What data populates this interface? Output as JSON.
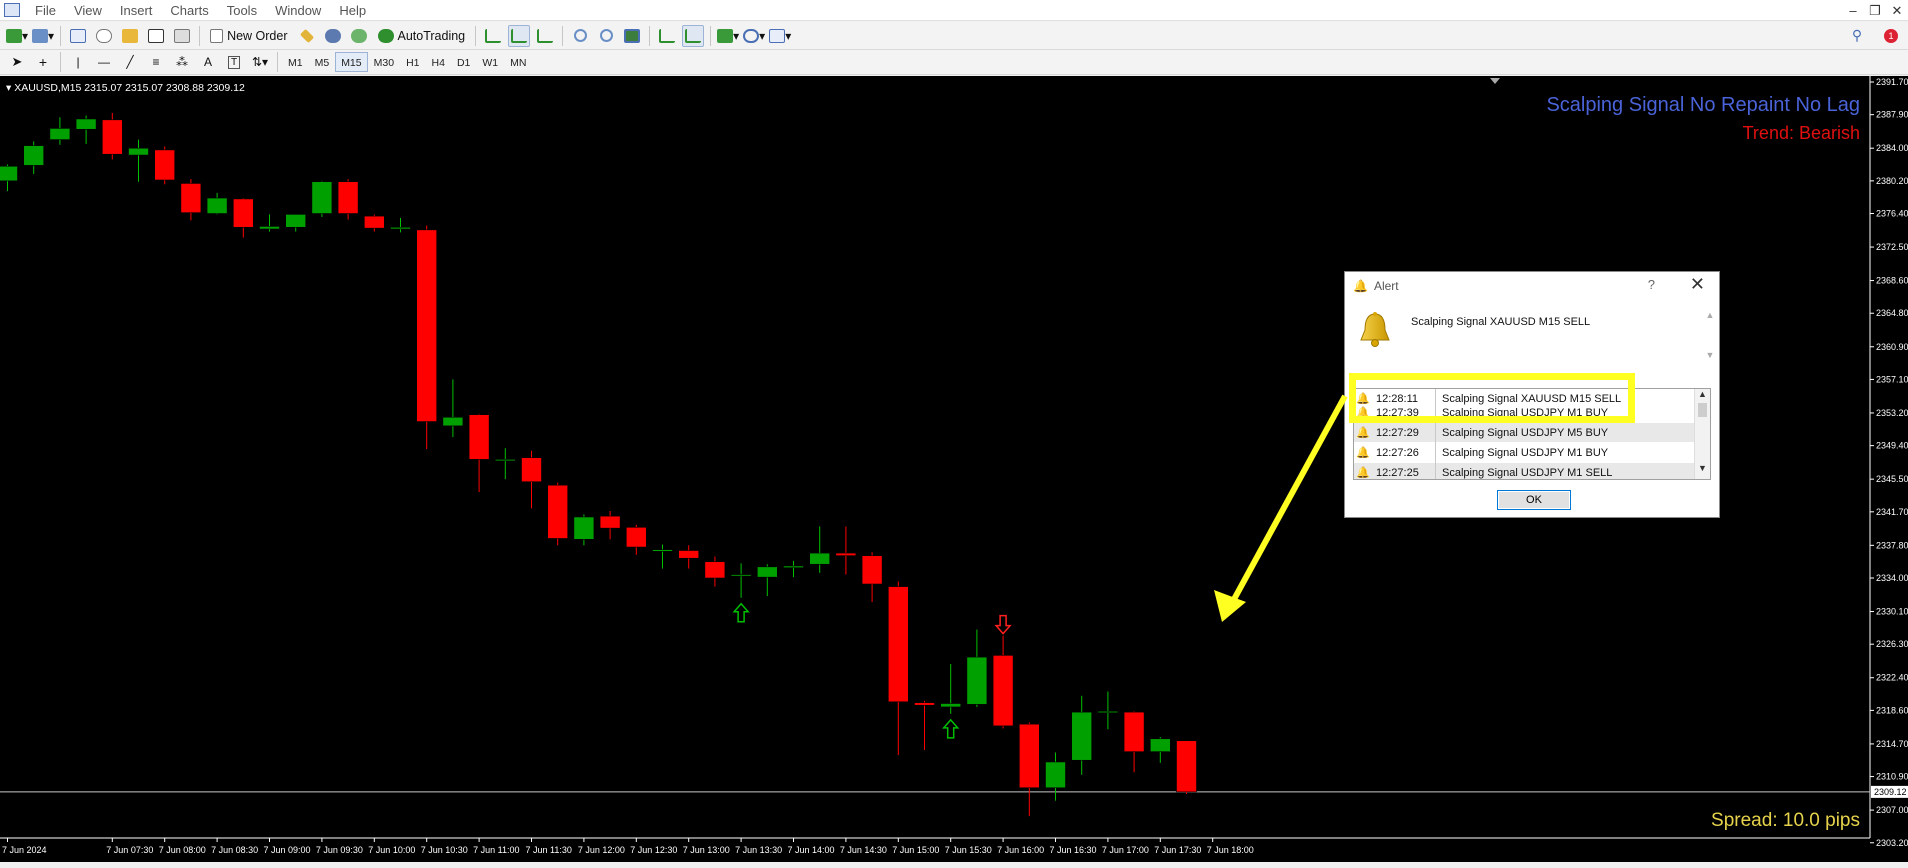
{
  "menu": {
    "items": [
      "File",
      "View",
      "Insert",
      "Charts",
      "Tools",
      "Window",
      "Help"
    ],
    "window_controls": [
      "–",
      "❐",
      "✕"
    ]
  },
  "toolbar": {
    "new_order_label": "New Order",
    "autotrading_label": "AutoTrading",
    "timeframes": [
      "M1",
      "M5",
      "M15",
      "M30",
      "H1",
      "H4",
      "D1",
      "W1",
      "MN"
    ],
    "active_timeframe": "M15",
    "drawing_tools": [
      "cursor-icon",
      "crosshair-icon",
      "vertical-line-icon",
      "horizontal-line-icon",
      "trendline-icon",
      "channel-icon",
      "fibonacci-icon",
      "text-icon",
      "label-icon",
      "arrows-icon"
    ]
  },
  "chart": {
    "symbol_info": "XAUUSD,M15  2315.07 2315.07 2308.88 2309.12",
    "indicator_title": "Scalping Signal No Repaint No Lag",
    "trend_label": "Trend: Bearish",
    "spread_label": "Spread: 10.0 pips",
    "current_price": "2309.12",
    "colors": {
      "bull": "#00a000",
      "bear": "#ff0000",
      "doji": "#00c000",
      "axis_text": "#ffffff",
      "buy_arrow": "#00c000",
      "sell_arrow": "#ff2020"
    }
  },
  "chart_data": {
    "type": "candlestick",
    "symbol": "XAUUSD",
    "timeframe": "M15",
    "ylim": [
      2303.29,
      2391.7
    ],
    "y_ticks": [
      "2391.70",
      "2387.90",
      "2384.00",
      "2380.20",
      "2376.40",
      "2372.50",
      "2368.60",
      "2364.80",
      "2360.90",
      "2357.10",
      "2353.20",
      "2349.40",
      "2345.50",
      "2341.70",
      "2337.80",
      "2334.00",
      "2330.10",
      "2326.30",
      "2322.40",
      "2318.60",
      "2314.70",
      "2310.90",
      "2307.00",
      "2303.20"
    ],
    "x_ticks": [
      "7 Jun 2024",
      "7 Jun 07:30",
      "7 Jun 08:00",
      "7 Jun 08:30",
      "7 Jun 09:00",
      "7 Jun 09:30",
      "7 Jun 10:00",
      "7 Jun 10:30",
      "7 Jun 11:00",
      "7 Jun 11:30",
      "7 Jun 12:00",
      "7 Jun 12:30",
      "7 Jun 13:00",
      "7 Jun 13:30",
      "7 Jun 14:00",
      "7 Jun 14:30",
      "7 Jun 15:00",
      "7 Jun 15:30",
      "7 Jun 16:00",
      "7 Jun 16:30",
      "7 Jun 17:00",
      "7 Jun 17:30",
      "7 Jun 18:00"
    ],
    "x_tick_index": [
      0,
      4,
      6,
      8,
      10,
      12,
      14,
      16,
      18,
      20,
      22,
      24,
      26,
      28,
      30,
      32,
      34,
      36,
      38,
      40,
      42,
      44,
      46
    ],
    "candles": [
      {
        "o": 2380.2,
        "h": 2382.1,
        "l": 2379.0,
        "c": 2381.9
      },
      {
        "o": 2382.0,
        "h": 2384.8,
        "l": 2381.0,
        "c": 2384.3
      },
      {
        "o": 2385.0,
        "h": 2387.6,
        "l": 2384.4,
        "c": 2386.3
      },
      {
        "o": 2386.2,
        "h": 2387.8,
        "l": 2384.5,
        "c": 2387.4
      },
      {
        "o": 2387.3,
        "h": 2388.1,
        "l": 2382.7,
        "c": 2383.3
      },
      {
        "o": 2383.2,
        "h": 2385.0,
        "l": 2380.1,
        "c": 2384.0
      },
      {
        "o": 2383.8,
        "h": 2384.2,
        "l": 2379.8,
        "c": 2380.3
      },
      {
        "o": 2379.9,
        "h": 2380.4,
        "l": 2375.6,
        "c": 2376.5
      },
      {
        "o": 2376.4,
        "h": 2378.8,
        "l": 2376.3,
        "c": 2378.2
      },
      {
        "o": 2378.1,
        "h": 2378.2,
        "l": 2373.6,
        "c": 2374.8
      },
      {
        "o": 2374.6,
        "h": 2376.3,
        "l": 2374.3,
        "c": 2374.9
      },
      {
        "o": 2374.8,
        "h": 2376.3,
        "l": 2374.3,
        "c": 2376.3
      },
      {
        "o": 2376.4,
        "h": 2380.2,
        "l": 2376.0,
        "c": 2380.1
      },
      {
        "o": 2380.1,
        "h": 2380.4,
        "l": 2375.7,
        "c": 2376.4
      },
      {
        "o": 2376.1,
        "h": 2376.3,
        "l": 2374.3,
        "c": 2374.7
      },
      {
        "o": 2374.6,
        "h": 2375.9,
        "l": 2374.2,
        "c": 2374.8
      },
      {
        "o": 2374.5,
        "h": 2375.0,
        "l": 2349.0,
        "c": 2352.2
      },
      {
        "o": 2351.7,
        "h": 2357.1,
        "l": 2350.4,
        "c": 2352.7
      },
      {
        "o": 2353.0,
        "h": 2353.1,
        "l": 2344.0,
        "c": 2347.8
      },
      {
        "o": 2347.8,
        "h": 2349.1,
        "l": 2345.5,
        "c": 2347.8
      },
      {
        "o": 2348.0,
        "h": 2348.8,
        "l": 2342.1,
        "c": 2345.2
      },
      {
        "o": 2344.8,
        "h": 2345.1,
        "l": 2337.8,
        "c": 2338.6
      },
      {
        "o": 2338.5,
        "h": 2341.4,
        "l": 2337.8,
        "c": 2341.1
      },
      {
        "o": 2341.2,
        "h": 2341.8,
        "l": 2338.5,
        "c": 2339.8
      },
      {
        "o": 2339.9,
        "h": 2340.2,
        "l": 2336.7,
        "c": 2337.6
      },
      {
        "o": 2337.1,
        "h": 2337.9,
        "l": 2335.1,
        "c": 2337.3
      },
      {
        "o": 2337.2,
        "h": 2337.8,
        "l": 2335.1,
        "c": 2336.3
      },
      {
        "o": 2335.9,
        "h": 2336.5,
        "l": 2333.0,
        "c": 2334.0
      },
      {
        "o": 2334.3,
        "h": 2335.7,
        "l": 2331.7,
        "c": 2334.4
      },
      {
        "o": 2334.1,
        "h": 2335.6,
        "l": 2331.9,
        "c": 2335.3
      },
      {
        "o": 2335.2,
        "h": 2336.0,
        "l": 2334.1,
        "c": 2335.4
      },
      {
        "o": 2335.6,
        "h": 2340.0,
        "l": 2334.6,
        "c": 2336.9
      },
      {
        "o": 2336.9,
        "h": 2340.0,
        "l": 2334.4,
        "c": 2336.6
      },
      {
        "o": 2336.6,
        "h": 2337.0,
        "l": 2331.2,
        "c": 2333.3
      },
      {
        "o": 2333.0,
        "h": 2333.6,
        "l": 2313.4,
        "c": 2319.6
      },
      {
        "o": 2319.5,
        "h": 2319.7,
        "l": 2314.0,
        "c": 2319.2
      },
      {
        "o": 2319.0,
        "h": 2324.0,
        "l": 2318.2,
        "c": 2319.4
      },
      {
        "o": 2319.3,
        "h": 2328.0,
        "l": 2319.0,
        "c": 2324.8
      },
      {
        "o": 2325.0,
        "h": 2327.3,
        "l": 2316.5,
        "c": 2316.8
      },
      {
        "o": 2317.0,
        "h": 2317.2,
        "l": 2306.3,
        "c": 2309.6
      },
      {
        "o": 2309.6,
        "h": 2313.7,
        "l": 2308.1,
        "c": 2312.6
      },
      {
        "o": 2312.8,
        "h": 2320.3,
        "l": 2311.1,
        "c": 2318.4
      },
      {
        "o": 2318.4,
        "h": 2320.8,
        "l": 2316.4,
        "c": 2318.5
      },
      {
        "o": 2318.4,
        "h": 2318.5,
        "l": 2311.4,
        "c": 2313.8
      },
      {
        "o": 2313.8,
        "h": 2315.5,
        "l": 2312.5,
        "c": 2315.3
      },
      {
        "o": 2315.07,
        "h": 2315.07,
        "l": 2308.88,
        "c": 2309.12
      }
    ],
    "signals": [
      {
        "index": 28,
        "type": "buy"
      },
      {
        "index": 36,
        "type": "buy"
      },
      {
        "index": 38,
        "type": "sell"
      }
    ]
  },
  "alert": {
    "title": "Alert",
    "help": "?",
    "close": "✕",
    "message": "Scalping Signal XAUUSD M15 SELL",
    "rows": [
      {
        "time": "12:28:11",
        "msg": "Scalping Signal XAUUSD M15 SELL"
      },
      {
        "time": "12:27:39",
        "msg": "Scalping Signal USDJPY M1 BUY"
      },
      {
        "time": "12:27:29",
        "msg": "Scalping Signal USDJPY M5 BUY"
      },
      {
        "time": "12:27:26",
        "msg": "Scalping Signal USDJPY M1 BUY"
      },
      {
        "time": "12:27:25",
        "msg": "Scalping Signal USDJPY M1 SELL"
      }
    ],
    "ok_label": "OK"
  },
  "annotation": {
    "highlight_color": "#ffff21"
  }
}
